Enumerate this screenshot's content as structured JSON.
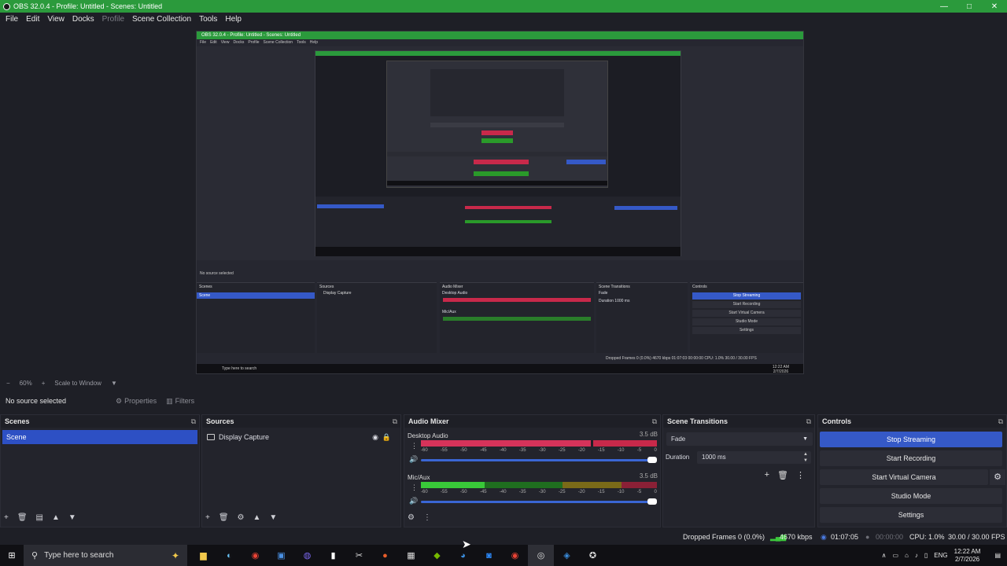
{
  "window": {
    "title": "OBS 32.0.4 - Profile: Untitled - Scenes: Untitled",
    "min": "—",
    "max": "□",
    "close": "✕"
  },
  "menu": [
    "File",
    "Edit",
    "View",
    "Docks",
    "Profile",
    "Scene Collection",
    "Tools",
    "Help"
  ],
  "nested": {
    "title": "OBS 32.0.4 - Profile: Untitled - Scenes: Untitled",
    "menu": [
      "File",
      "Edit",
      "View",
      "Docks",
      "Profile",
      "Scene Collection",
      "Tools",
      "Help"
    ],
    "zoom": "60%",
    "scale": "Scale to Window",
    "no_source": "No source selected",
    "properties": "Properties",
    "filters": "Filters",
    "scenes": "Scenes",
    "scene_item": "Scene",
    "sources": "Sources",
    "source_item": "Display Capture",
    "audio_mixer": "Audio Mixer",
    "desktop_audio": "Desktop Audio",
    "mic_aux": "Mic/Aux",
    "db": "3.5 dB",
    "transitions": "Scene Transitions",
    "fade": "Fade",
    "duration": "Duration",
    "duration_val": "1000 ms",
    "controls": "Controls",
    "stop_streaming": "Stop Streaming",
    "start_recording": "Start Recording",
    "start_virtual_camera": "Start Virtual Camera",
    "studio_mode": "Studio Mode",
    "settings": "Settings",
    "search": "Type here to search",
    "status": "Dropped Frames 0 (0.0%)   4670 kbps   01:07:03   00:00:00   CPU: 1.0%   30.00 / 30.00 FPS",
    "clock_time": "12:22 AM",
    "clock_date": "2/7/2026"
  },
  "zoombar": {
    "zoom": "60%",
    "scale": "Scale to Window"
  },
  "props": {
    "no_source": "No source selected",
    "properties": "Properties",
    "filters": "Filters"
  },
  "scenes": {
    "title": "Scenes",
    "items": [
      "Scene"
    ]
  },
  "sources": {
    "title": "Sources",
    "items": [
      "Display Capture"
    ]
  },
  "mixer": {
    "title": "Audio Mixer",
    "channels": [
      {
        "name": "Desktop Audio",
        "db": "3.5 dB"
      },
      {
        "name": "Mic/Aux",
        "db": "3.5 dB"
      }
    ],
    "ticks": [
      "-60",
      "-55",
      "-50",
      "-45",
      "-40",
      "-35",
      "-30",
      "-25",
      "-20",
      "-15",
      "-10",
      "-5",
      "0"
    ]
  },
  "transitions": {
    "title": "Scene Transitions",
    "selected": "Fade",
    "duration_label": "Duration",
    "duration_value": "1000 ms"
  },
  "controls": {
    "title": "Controls",
    "stop_streaming": "Stop Streaming",
    "start_recording": "Start Recording",
    "start_virtual_camera": "Start Virtual Camera",
    "studio_mode": "Studio Mode",
    "settings": "Settings"
  },
  "status": {
    "dropped": "Dropped Frames 0 (0.0%)",
    "bitrate": "4670 kbps",
    "stream_time": "01:07:05",
    "record_time": "00:00:00",
    "cpu": "CPU: 1.0%",
    "fps": "30.00 / 30.00 FPS"
  },
  "taskbar": {
    "search": "Type here to search",
    "lang": "ENG",
    "time": "12:22 AM",
    "date": "2/7/2026"
  },
  "colors": {
    "accent": "#3559c7",
    "titlebar": "#2b9a3c",
    "meter_red": "#c8294a",
    "meter_green": "#2a9a2a"
  }
}
